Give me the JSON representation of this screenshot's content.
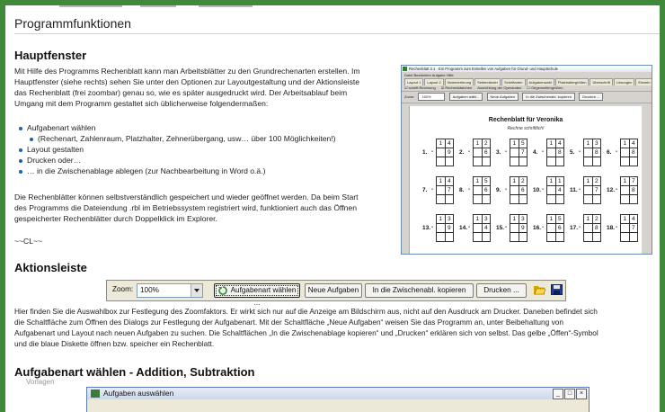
{
  "page_title": "Programmfunktionen",
  "hauptfenster": {
    "heading": "Hauptfenster",
    "para1": [
      "Mit Hilfe des Programms Rechenblatt kann man Arbeitsblätter zu den Grundrechenarten erstellen. Im",
      "Hauptfenster (siehe rechts) sehen Sie unter den Optionen zur Layoutgestaltung und der Aktionsleiste",
      "das Rechenblatt (frei zoombar) genau so, wie es später ausgedruckt wird. Der Arbeitsablauf beim",
      "Umgang mit dem Programm gestaltet sich üblicherweise folgendermaßen:"
    ],
    "bullets": [
      "Aufgabenart wählen",
      "(Rechenart, Zahlenraum, Platzhalter, Zehnerübergang, usw… über 100 Möglichkeiten!)",
      "Layout gestalten",
      "Drucken oder…",
      "… in die Zwischenablage ablegen (zur Nachbearbeitung in Word o.ä.)"
    ],
    "para2": [
      "Die Rechenblätter können selbstverständlich gespeichert und wieder geöffnet werden. Da beim Start",
      "des Programms die Dateiendung .rbl im Betriebssystem registriert wird, funktioniert auch das Öffnen",
      "gespeicherter Rechenblätter durch Doppelklick im Explorer."
    ],
    "sign": "~~CL~~"
  },
  "screenshot": {
    "window_title": "Rechenblatt 3.1 · Ein Programm zum Erstellen von Aufgaben für Grund- und Hauptschule",
    "menu": "Datei    Bearbeiten    Aufgabe    Hilfe",
    "tabs": [
      "Layout 1",
      "Layout 2",
      "Nummerierung",
      "Seitenränder",
      "Schriftarten",
      "Aufgabenwahl",
      "Platzhaltergrößen",
      "Überschrift",
      "Lösungen",
      "Einzeln bearbeiten"
    ],
    "opts": [
      "☑ schrift.Rechnung",
      "☑ Rechenkästchen",
      "Ausrichtung der Operanden",
      "☐ Gegenseitengrößen"
    ],
    "zoom_label": "Zoom:",
    "zoom_value": "100%",
    "buttons": [
      "Aufgaben wähl...",
      "Neue Aufgaben",
      "In die Zwischenabl. kopieren",
      "Drucken ..."
    ],
    "sheet_title": "Rechenblatt für Veronika",
    "sheet_sub": "Rechne schriftlich!",
    "problems": [
      {
        "n": "1.",
        "a": [
          "1",
          "4"
        ],
        "b": [
          "",
          "9"
        ]
      },
      {
        "n": "2.",
        "a": [
          "1",
          "2"
        ],
        "b": [
          "",
          "6"
        ]
      },
      {
        "n": "3.",
        "a": [
          "1",
          "5"
        ],
        "b": [
          "",
          "7"
        ]
      },
      {
        "n": "4.",
        "a": [
          "1",
          "4"
        ],
        "b": [
          "",
          "8"
        ]
      },
      {
        "n": "5.",
        "a": [
          "1",
          "3"
        ],
        "b": [
          "",
          "8"
        ]
      },
      {
        "n": "6.",
        "a": [
          "1",
          "4"
        ],
        "b": [
          "",
          "8"
        ]
      },
      {
        "n": "7.",
        "a": [
          "1",
          "4"
        ],
        "b": [
          "",
          "7"
        ]
      },
      {
        "n": "8.",
        "a": [
          "1",
          "5"
        ],
        "b": [
          "",
          "6"
        ]
      },
      {
        "n": "9.",
        "a": [
          "1",
          "2"
        ],
        "b": [
          "",
          "6"
        ]
      },
      {
        "n": "10.",
        "a": [
          "1",
          "1"
        ],
        "b": [
          "",
          "4"
        ]
      },
      {
        "n": "11.",
        "a": [
          "1",
          "2"
        ],
        "b": [
          "",
          "7"
        ]
      },
      {
        "n": "12.",
        "a": [
          "1",
          "7"
        ],
        "b": [
          "",
          "8"
        ]
      },
      {
        "n": "13.",
        "a": [
          "1",
          "3"
        ],
        "b": [
          "",
          "9"
        ]
      },
      {
        "n": "14.",
        "a": [
          "1",
          "3"
        ],
        "b": [
          "",
          "4"
        ]
      },
      {
        "n": "15.",
        "a": [
          "1",
          "3"
        ],
        "b": [
          "",
          "9"
        ]
      },
      {
        "n": "16.",
        "a": [
          "1",
          "5"
        ],
        "b": [
          "",
          "6"
        ]
      },
      {
        "n": "17.",
        "a": [
          "1",
          "2"
        ],
        "b": [
          "",
          "8"
        ]
      },
      {
        "n": "18.",
        "a": [
          "1",
          "4"
        ],
        "b": [
          "",
          "7"
        ]
      }
    ]
  },
  "aktionsleiste": {
    "heading": "Aktionsleiste",
    "zoom_label": "Zoom:",
    "zoom_value": "100%",
    "btn_aufgabenart": "Aufgabenart wählen ...",
    "btn_neue": "Neue Aufgaben",
    "btn_zwischenablage": "In die Zwischenabl. kopieren",
    "btn_drucken": "Drucken ...",
    "para": [
      "Hier finden Sie die Auswahlbox zur Festlegung des Zoomfaktors. Er wirkt sich nur auf die Anzeige am Bildschirm aus, nicht auf den Ausdruck am Drucker. Daneben befindet sich",
      "die Schaltfläche zum Öffnen des Dialogs zur Festlegung der Aufgabenart. Mit der Schaltfläche „Neue Aufgaben“ weisen Sie das Programm an, unter Beibehaltung von",
      "Aufgabenart und Layout nach neuen Aufgaben zu suchen. Die Schaltflächen „In die Zwischenablage kopieren“ und „Drucken“ erklären sich von selbst. Das gelbe „Öffen“-Symbol",
      "und die blaue Diskette öffnen bzw. speicher ein Rechenblatt."
    ]
  },
  "aufgabenart": {
    "heading": "Aufgabenart wählen - Addition, Subtraktion",
    "vorlagen": "Vorlagen",
    "dialog_title": "Aufgaben auswählen"
  },
  "colors": {
    "frame": "#3f8a3a",
    "accent": "#1a5fb4"
  }
}
